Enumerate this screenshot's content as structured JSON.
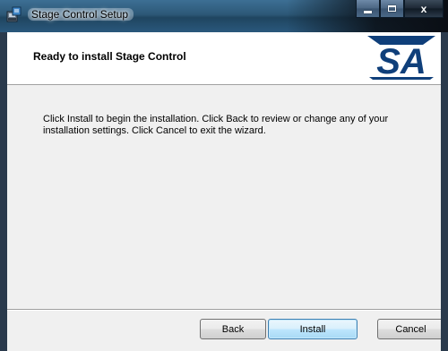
{
  "window": {
    "title": "Stage Control Setup",
    "icon": "installer-icon",
    "controls": {
      "minimize": "minimize-icon",
      "maximize": "maximize-icon",
      "close": "x"
    }
  },
  "banner": {
    "title": "Ready to install Stage Control",
    "logo_text": "SA",
    "logo_color": "#0f3f7a"
  },
  "body": {
    "message": "Click Install to begin the installation. Click Back to review or change any of your installation settings. Click Cancel to exit the wizard."
  },
  "buttons": {
    "back": "Back",
    "install": "Install",
    "cancel": "Cancel"
  }
}
